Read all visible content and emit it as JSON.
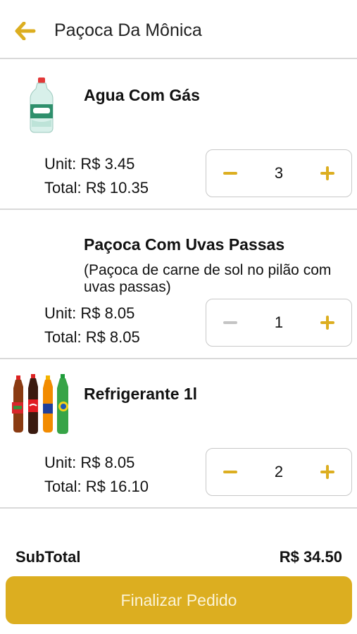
{
  "header": {
    "title": "Paçoca Da Mônica",
    "back_icon": "arrow-left-icon"
  },
  "colors": {
    "accent": "#dcae20",
    "divider": "#d9d9d9",
    "disabled": "#c4c4c4"
  },
  "items": [
    {
      "name": "Agua Com Gás",
      "description": "",
      "image": "water-bottle-image",
      "unit": "Unit: R$ 3.45",
      "total": "Total: R$ 10.35",
      "quantity": "3",
      "minus_disabled": false
    },
    {
      "name": "Paçoca Com Uvas Passas",
      "description": "(Paçoca de carne de sol no pilão com uvas passas)",
      "image": "",
      "unit": "Unit: R$ 8.05",
      "total": "Total: R$ 8.05",
      "quantity": "1",
      "minus_disabled": true
    },
    {
      "name": "Refrigerante 1l",
      "description": "",
      "image": "soda-bottles-image",
      "unit": "Unit: R$ 8.05",
      "total": "Total: R$ 16.10",
      "quantity": "2",
      "minus_disabled": false
    }
  ],
  "summary": {
    "subtotal_label": "SubTotal",
    "subtotal_value": "R$ 34.50"
  },
  "checkout": {
    "label": "Finalizar Pedido"
  }
}
